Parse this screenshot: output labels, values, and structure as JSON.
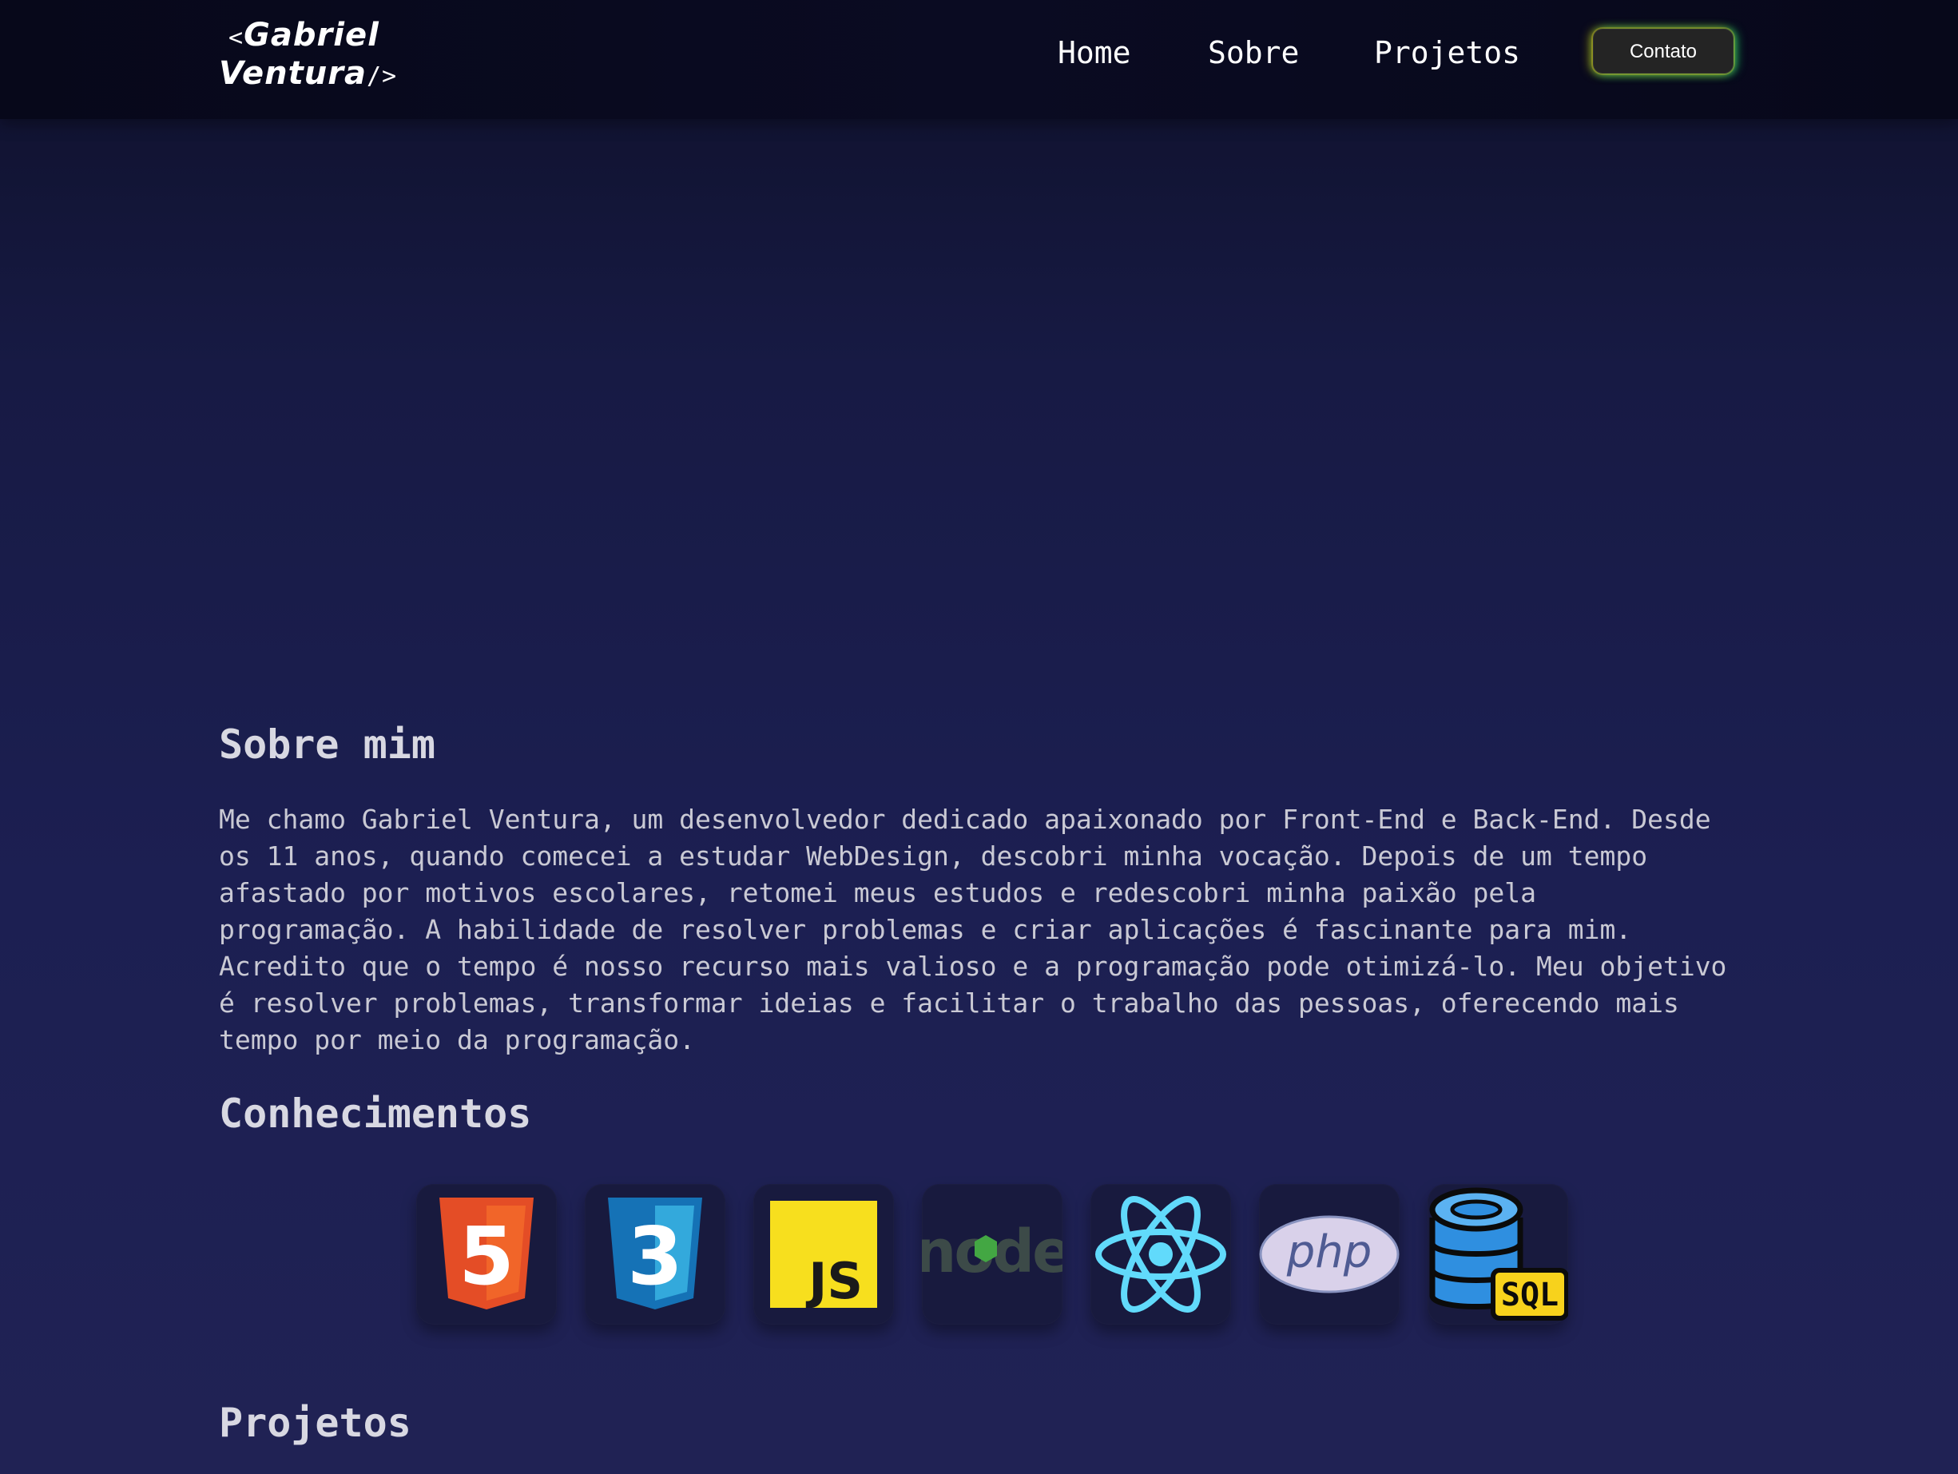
{
  "header": {
    "logo_line1": "Gabriel",
    "logo_line2": "Ventura",
    "logo_open": "<",
    "logo_close": "/>",
    "nav": [
      {
        "label": "Home"
      },
      {
        "label": "Sobre"
      },
      {
        "label": "Projetos"
      }
    ],
    "contact_label": "Contato"
  },
  "about": {
    "title": "Sobre mim",
    "lines": [
      "Me chamo Gabriel Ventura, um desenvolvedor dedicado apaixonado por Front-End e Back-End. Desde",
      "os 11 anos, quando comecei a estudar WebDesign, descobri minha vocação. Depois de um tempo",
      "afastado por motivos escolares, retomei meus estudos e redescobri minha paixão pela",
      "programação. A habilidade de resolver problemas e criar aplicações é fascinante para mim.",
      "Acredito que o tempo é nosso recurso mais valioso e a programação pode otimizá-lo. Meu objetivo",
      "é resolver problemas, transformar ideias e facilitar o trabalho das pessoas, oferecendo mais",
      "tempo por meio da programação."
    ]
  },
  "skills": {
    "title": "Conhecimentos",
    "items": [
      {
        "icon": "html5-icon",
        "label": "5"
      },
      {
        "icon": "css3-icon",
        "label": "3"
      },
      {
        "icon": "javascript-icon",
        "label": "JS"
      },
      {
        "icon": "nodejs-icon",
        "label": "node"
      },
      {
        "icon": "react-icon"
      },
      {
        "icon": "php-icon",
        "label": "php"
      },
      {
        "icon": "sql-database-icon",
        "label": "SQL"
      }
    ]
  },
  "projects": {
    "title": "Projetos"
  },
  "colors": {
    "background_top": "#0e1029",
    "background_bottom": "#202254",
    "header_bg": "#07081a",
    "button_bg": "#242424",
    "glow_yellow": "#f0c800",
    "glow_green": "#28e678",
    "heading_text": "#d8d8e2",
    "body_text": "#c9c9d4"
  }
}
